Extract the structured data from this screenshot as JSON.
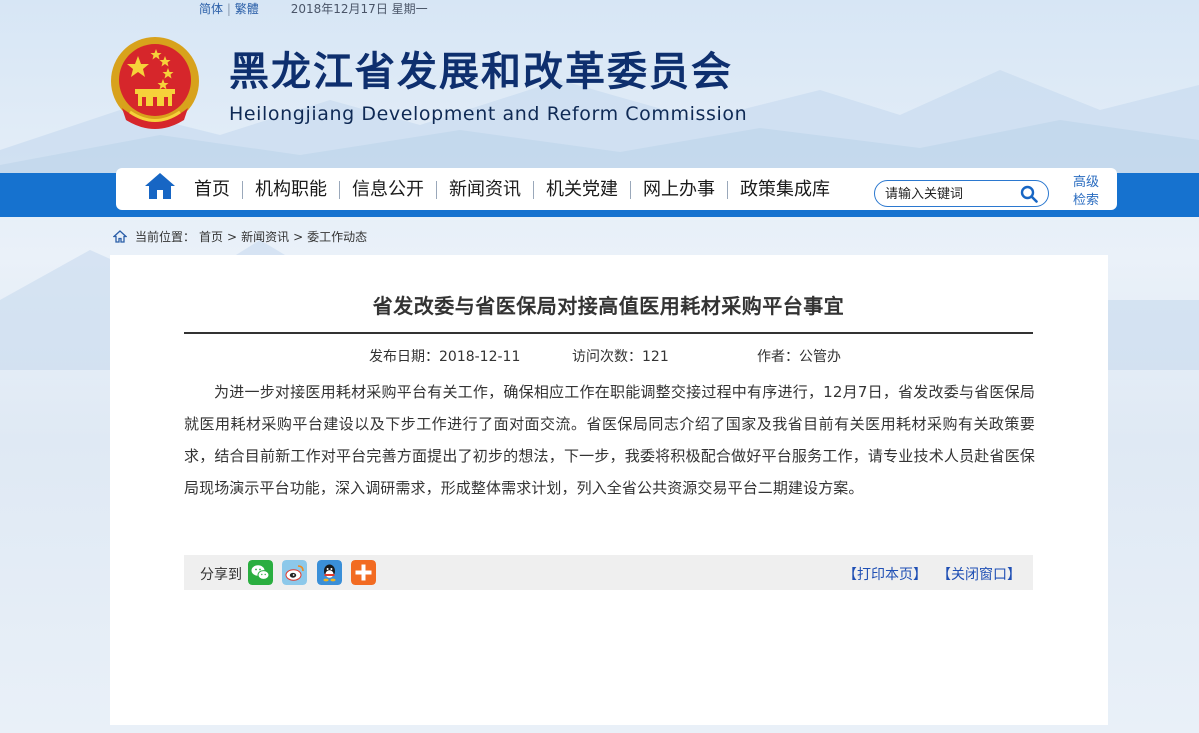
{
  "topbar": {
    "lang_simplified": "简体",
    "lang_separator": "|",
    "lang_traditional": "繁體",
    "date": "2018年12月17日 星期一"
  },
  "header": {
    "title_cn": "黑龙江省发展和改革委员会",
    "title_en": "Heilongjiang Development and Reform Commission"
  },
  "nav": {
    "items": [
      {
        "label": "首页"
      },
      {
        "label": "机构职能"
      },
      {
        "label": "信息公开"
      },
      {
        "label": "新闻资讯"
      },
      {
        "label": "机关党建"
      },
      {
        "label": "网上办事"
      },
      {
        "label": "政策集成库"
      }
    ],
    "search_placeholder": "请输入关键词",
    "advanced_line1": "高级",
    "advanced_line2": "检索"
  },
  "breadcrumb": {
    "label": "当前位置：",
    "items": [
      "首页",
      "新闻资讯",
      "委工作动态"
    ],
    "separator": ">"
  },
  "article": {
    "title": "省发改委与省医保局对接高值医用耗材采购平台事宜",
    "publish_date": "发布日期：2018-12-11",
    "visits": "访问次数：121",
    "author": "作者：公管办",
    "body": "为进一步对接医用耗材采购平台有关工作，确保相应工作在职能调整交接过程中有序进行，12月7日，省发改委与省医保局就医用耗材采购平台建设以及下步工作进行了面对面交流。省医保局同志介绍了国家及我省目前有关医用耗材采购有关政策要求，结合目前新工作对平台完善方面提出了初步的想法，下一步，我委将积极配合做好平台服务工作，请专业技术人员赴省医保局现场演示平台功能，深入调研需求，形成整体需求计划，列入全省公共资源交易平台二期建设方案。"
  },
  "share": {
    "label": "分享到",
    "icons": [
      "wechat-icon",
      "weibo-icon",
      "qq-icon",
      "more-share-icon"
    ],
    "print_label": "【打印本页】",
    "close_label": "【关闭窗口】"
  },
  "colors": {
    "nav_band": "#1672cf",
    "title_navy": "#0e2f6e",
    "link_blue": "#1f4fb4",
    "wechat_green": "#2aae40",
    "weibo_bg": "#8cc8ea",
    "qq_bg": "#3a8fd8",
    "more_orange": "#f26b22"
  }
}
